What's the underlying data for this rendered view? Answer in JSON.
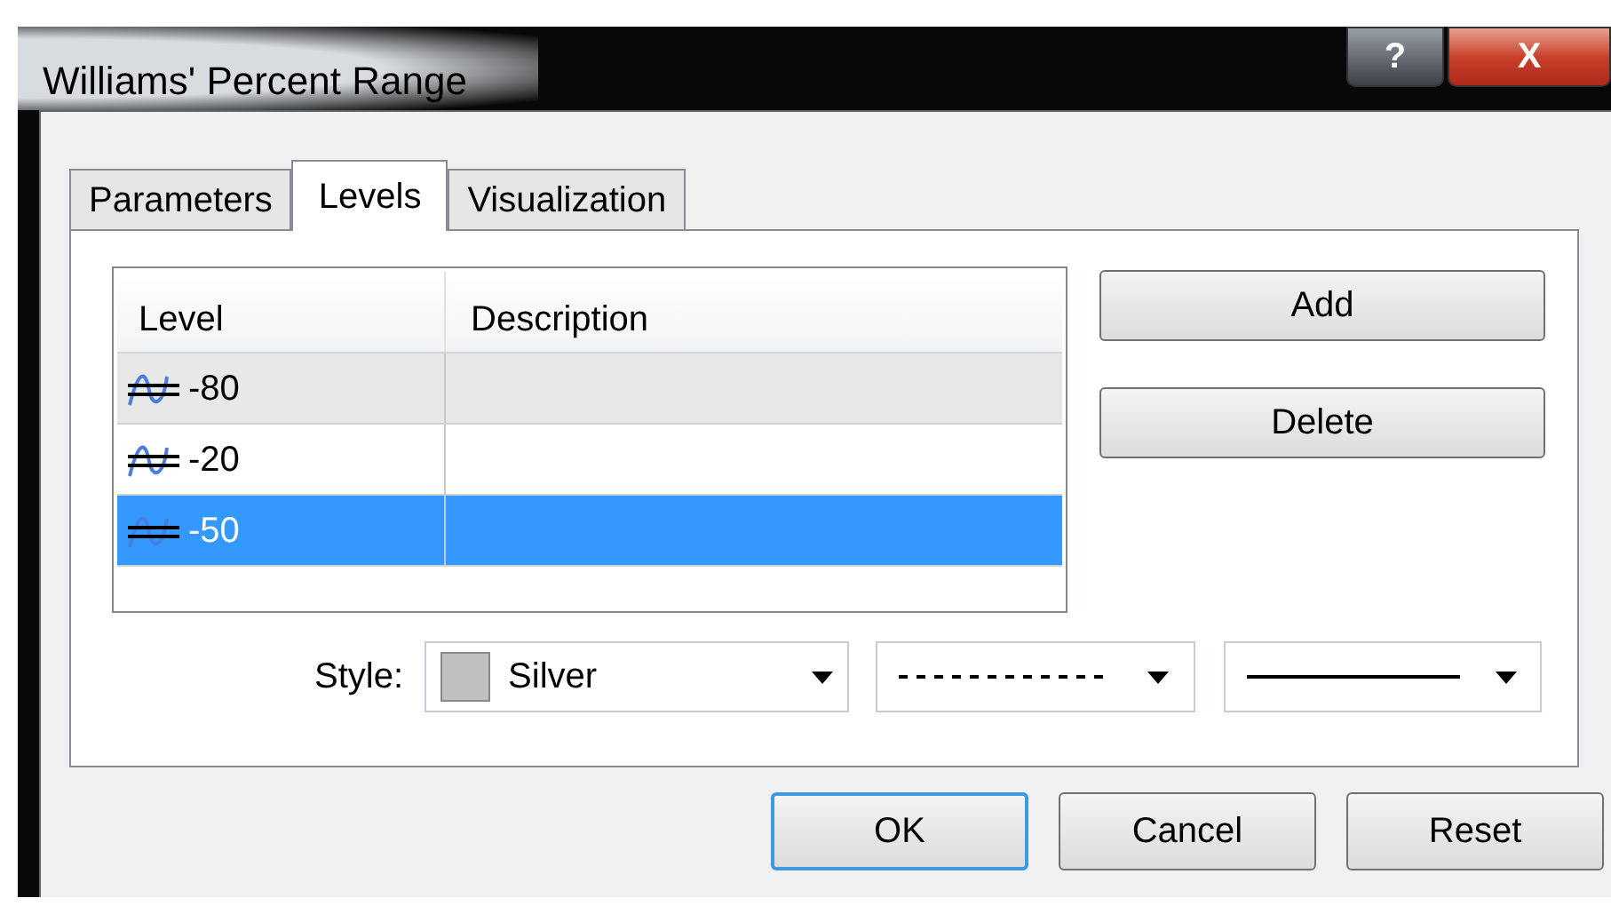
{
  "window": {
    "title": "Williams' Percent Range",
    "title_buttons": [
      {
        "kind": "help",
        "label": "?"
      },
      {
        "kind": "close",
        "label": "X"
      }
    ]
  },
  "tabs": [
    {
      "label": "Parameters",
      "selected": false
    },
    {
      "label": "Levels",
      "selected": true
    },
    {
      "label": "Visualization",
      "selected": false
    }
  ],
  "table": {
    "columns": [
      "Level",
      "Description"
    ],
    "rows": [
      {
        "level": "-80",
        "selected": false,
        "hover": true
      },
      {
        "level": "-20",
        "selected": false,
        "hover": false
      },
      {
        "level": "-50",
        "selected": true,
        "hover": false
      }
    ]
  },
  "side_buttons": [
    "Add",
    "Delete"
  ],
  "style": {
    "label": "Style:",
    "color": {
      "name": "Silver",
      "color": "#c0c0c0"
    },
    "line_style": {
      "kind": "dashed"
    },
    "line_width": {
      "kind": "thin"
    }
  },
  "buttons": [
    {
      "label": "OK",
      "default": true
    },
    {
      "label": "Cancel",
      "default": false
    },
    {
      "label": "Reset",
      "default": false
    }
  ]
}
